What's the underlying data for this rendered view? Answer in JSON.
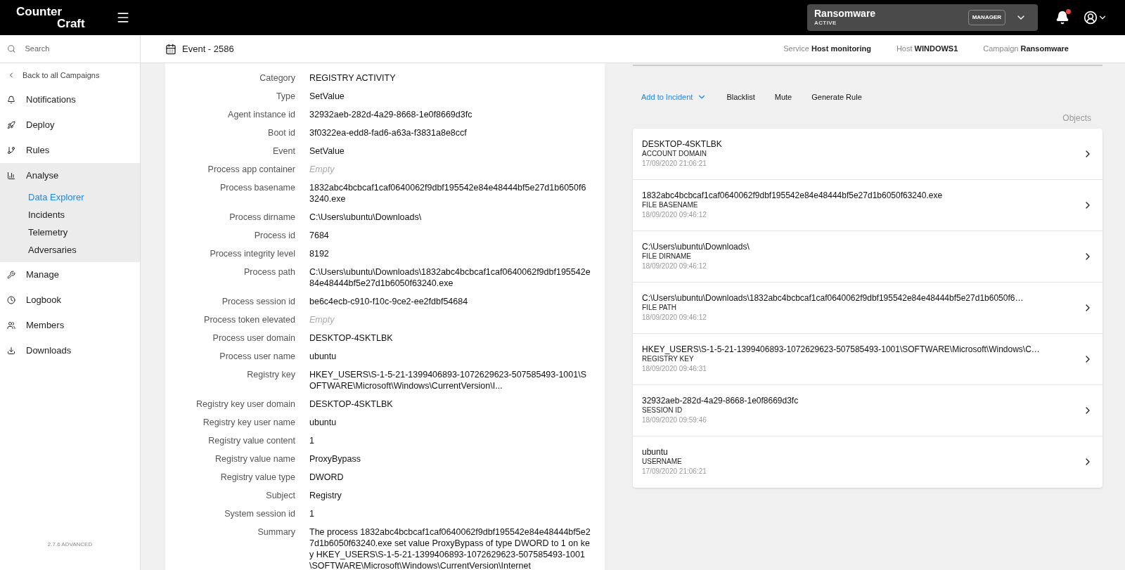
{
  "header": {
    "logo_line_1": "Counter",
    "logo_line_2": "Craft",
    "campaign": {
      "name": "Ransomware",
      "status": "ACTIVE",
      "role": "MANAGER"
    },
    "notifications": {
      "unread": true
    }
  },
  "sidebar": {
    "search": {
      "placeholder": "Search"
    },
    "back_link": "Back to all Campaigns",
    "items": [
      {
        "label": "Notifications",
        "expanded": false
      },
      {
        "label": "Deploy",
        "expanded": false
      },
      {
        "label": "Rules",
        "expanded": false
      },
      {
        "label": "Analyse",
        "expanded": true,
        "children": [
          {
            "label": "Data Explorer",
            "selected": true
          },
          {
            "label": "Incidents",
            "selected": false
          },
          {
            "label": "Telemetry",
            "selected": false
          },
          {
            "label": "Adversaries",
            "selected": false
          }
        ]
      },
      {
        "label": "Manage",
        "expanded": false
      },
      {
        "label": "Logbook",
        "expanded": false
      },
      {
        "label": "Members",
        "expanded": false
      },
      {
        "label": "Downloads",
        "expanded": false
      }
    ],
    "version": "2.7.6 ADVANCED"
  },
  "page": {
    "title": "Event - 2586",
    "context": [
      {
        "label": "Service",
        "value": "Host monitoring"
      },
      {
        "label": "Host",
        "value": "WINDOWS1"
      },
      {
        "label": "Campaign",
        "value": "Ransomware"
      }
    ]
  },
  "details": [
    {
      "label": "Category",
      "value": "REGISTRY ACTIVITY",
      "empty": false
    },
    {
      "label": "Type",
      "value": "SetValue",
      "empty": false
    },
    {
      "label": "Agent instance id",
      "value": "32932aeb-282d-4a29-8668-1e0f8669d3fc",
      "empty": false
    },
    {
      "label": "Boot id",
      "value": "3f0322ea-edd8-fad6-a63a-f3831a8e8ccf",
      "empty": false
    },
    {
      "label": "Event",
      "value": "SetValue",
      "empty": false
    },
    {
      "label": "Process app container",
      "value": "Empty",
      "empty": true
    },
    {
      "label": "Process basename",
      "value": "1832abc4bcbcaf1caf0640062f9dbf195542e84e48444bf5e27d1b6050f63240.exe",
      "empty": false
    },
    {
      "label": "Process dirname",
      "value": "C:\\Users\\ubuntu\\Downloads\\",
      "empty": false
    },
    {
      "label": "Process id",
      "value": "7684",
      "empty": false
    },
    {
      "label": "Process integrity level",
      "value": "8192",
      "empty": false
    },
    {
      "label": "Process path",
      "value": "C:\\Users\\ubuntu\\Downloads\\1832abc4bcbcaf1caf0640062f9dbf195542e84e48444bf5e27d1b6050f63240.exe",
      "empty": false
    },
    {
      "label": "Process session id",
      "value": "be6c4ecb-c910-f10c-9ce2-ee2fdbf54684",
      "empty": false
    },
    {
      "label": "Process token elevated",
      "value": "Empty",
      "empty": true
    },
    {
      "label": "Process user domain",
      "value": "DESKTOP-4SKTLBK",
      "empty": false
    },
    {
      "label": "Process user name",
      "value": "ubuntu",
      "empty": false
    },
    {
      "label": "Registry key",
      "value": "HKEY_USERS\\S-1-5-21-1399406893-1072629623-507585493-1001\\SOFTWARE\\Microsoft\\Windows\\CurrentVersion\\I...",
      "empty": false
    },
    {
      "label": "Registry key user domain",
      "value": "DESKTOP-4SKTLBK",
      "empty": false
    },
    {
      "label": "Registry key user name",
      "value": "ubuntu",
      "empty": false
    },
    {
      "label": "Registry value content",
      "value": "1",
      "empty": false
    },
    {
      "label": "Registry value name",
      "value": "ProxyBypass",
      "empty": false
    },
    {
      "label": "Registry value type",
      "value": "DWORD",
      "empty": false
    },
    {
      "label": "Subject",
      "value": "Registry",
      "empty": false
    },
    {
      "label": "System session id",
      "value": "1",
      "empty": false
    },
    {
      "label": "Summary",
      "value": "The process 1832abc4bcbcaf1caf0640062f9dbf195542e84e48444bf5e27d1b6050f63240.exe set value ProxyBypass of type DWORD to 1 on key HKEY_USERS\\S-1-5-21-1399406893-1072629623-507585493-1001\\SOFTWARE\\Microsoft\\Windows\\CurrentVersion\\Internet",
      "empty": false
    }
  ],
  "actions": {
    "primary": "Add to Incident",
    "buttons": [
      "Blacklist",
      "Mute",
      "Generate Rule"
    ]
  },
  "objects": {
    "title": "Objects",
    "items": [
      {
        "value": "DESKTOP-4SKTLBK",
        "type": "ACCOUNT DOMAIN",
        "date": "17/09/2020 21:06:21"
      },
      {
        "value": "1832abc4bcbcaf1caf0640062f9dbf195542e84e48444bf5e27d1b6050f63240.exe",
        "type": "FILE BASENAME",
        "date": "18/09/2020 09:46:12"
      },
      {
        "value": "C:\\Users\\ubuntu\\Downloads\\",
        "type": "FILE DIRNAME",
        "date": "18/09/2020 09:46:12"
      },
      {
        "value": "C:\\Users\\ubuntu\\Downloads\\1832abc4bcbcaf1caf0640062f9dbf195542e84e48444bf5e27d1b6050f6…",
        "type": "FILE PATH",
        "date": "18/09/2020 09:46:12"
      },
      {
        "value": "HKEY_USERS\\S-1-5-21-1399406893-1072629623-507585493-1001\\SOFTWARE\\Microsoft\\Windows\\C…",
        "type": "REGISTRY KEY",
        "date": "18/09/2020 09:46:31"
      },
      {
        "value": "32932aeb-282d-4a29-8668-1e0f8669d3fc",
        "type": "SESSION ID",
        "date": "18/09/2020 09:59:46"
      },
      {
        "value": "ubuntu",
        "type": "USERNAME",
        "date": "17/09/2020 21:06:21"
      }
    ]
  }
}
